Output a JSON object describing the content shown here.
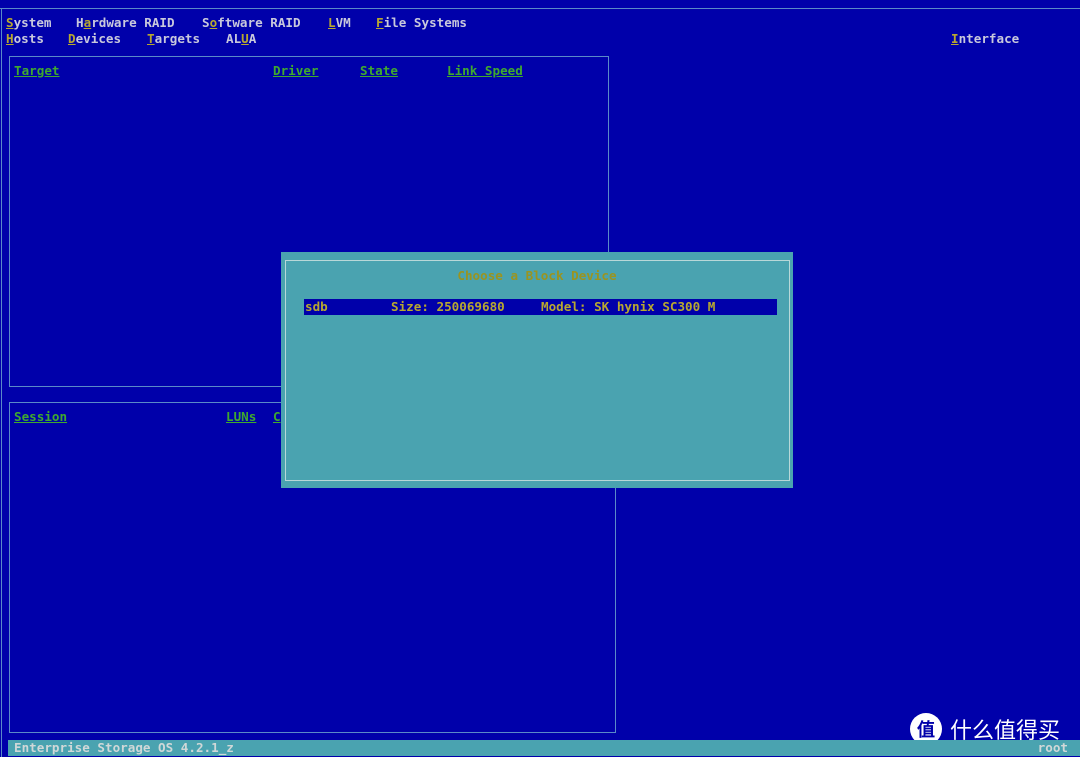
{
  "menu_row1": [
    {
      "pre": "",
      "hot": "S",
      "post": "ystem"
    },
    {
      "pre": "H",
      "hot": "a",
      "post": "rdware RAID"
    },
    {
      "pre": "S",
      "hot": "o",
      "post": "ftware RAID"
    },
    {
      "pre": "",
      "hot": "L",
      "post": "VM"
    },
    {
      "pre": "",
      "hot": "F",
      "post": "ile Systems"
    }
  ],
  "menu_row2": [
    {
      "pre": "",
      "hot": "H",
      "post": "osts"
    },
    {
      "pre": "",
      "hot": "D",
      "post": "evices"
    },
    {
      "pre": "",
      "hot": "T",
      "post": "argets"
    },
    {
      "pre": "AL",
      "hot": "U",
      "post": "A"
    }
  ],
  "interface": {
    "hot": "I",
    "post": "nterface"
  },
  "targets_panel": {
    "headers": [
      "Target",
      "Driver",
      "State",
      "Link Speed"
    ]
  },
  "sessions_panel": {
    "headers": [
      "Session",
      "LUNs",
      "C"
    ]
  },
  "dialog": {
    "title": "Choose a Block Device",
    "items": [
      {
        "name": "sdb",
        "size": "Size: 250069680",
        "model": "Model: SK hynix SC300 M"
      }
    ]
  },
  "status": {
    "left": "Enterprise Storage OS 4.2.1_z",
    "right": "root"
  },
  "watermark": {
    "icon": "值",
    "text": "什么值得买"
  },
  "colors": {
    "background": "#0000aa",
    "dialog": "#4aa3b0",
    "header": "#3faa2e",
    "hotkey": "#b8a830"
  }
}
